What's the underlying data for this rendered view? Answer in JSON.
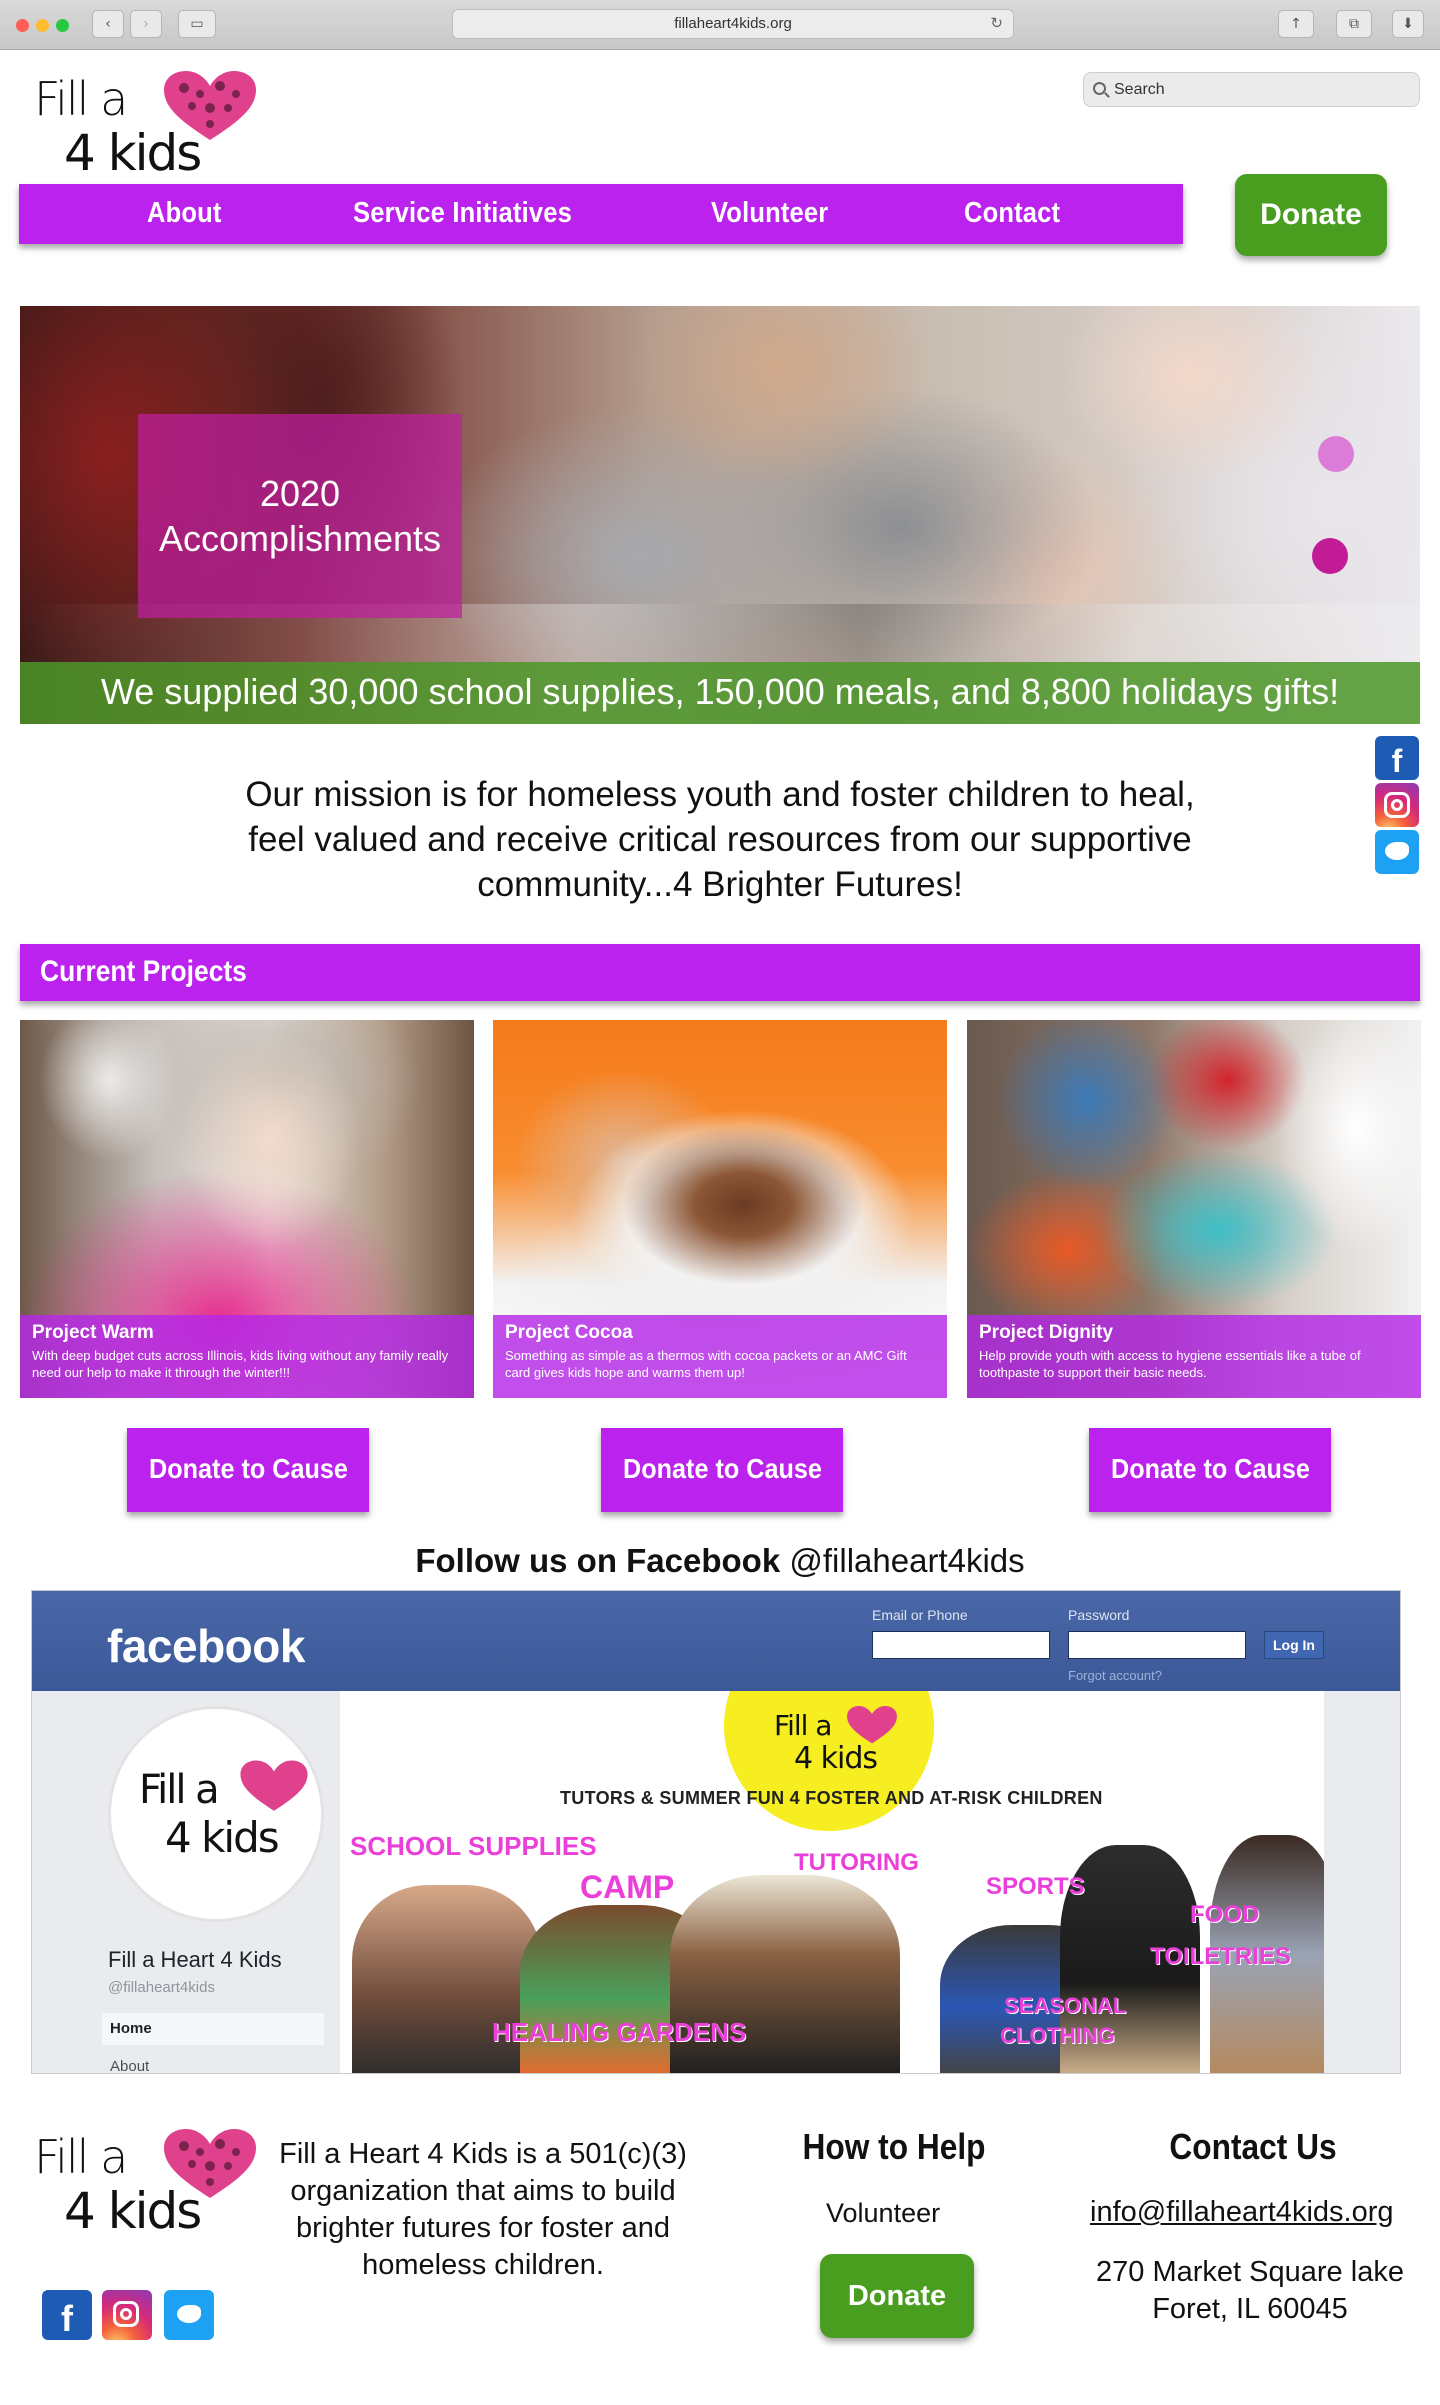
{
  "browser": {
    "url": "fillaheart4kids.org"
  },
  "logo": {
    "line1": "Fill a",
    "line2": "4 kids",
    "heart_color": "#e0418d"
  },
  "search": {
    "placeholder": "Search",
    "icon": "search-icon"
  },
  "nav": {
    "items": [
      "About",
      "Service Initiatives",
      "Volunteer",
      "Contact"
    ],
    "donate_label": "Donate",
    "bar_color": "#bb22ee",
    "donate_color": "#4a9e1f"
  },
  "hero": {
    "overlay_line1": "2020",
    "overlay_line2": "Accomplishments",
    "banner": "We supplied 30,000 school supplies, 150,000 meals, and 8,800 holidays gifts!"
  },
  "social": {
    "facebook": "facebook-icon",
    "instagram": "instagram-icon",
    "twitter": "twitter-icon"
  },
  "mission": {
    "text": "Our mission is for homeless youth and foster children to heal, feel valued and receive critical resources from our supportive community...4 Brighter Futures!"
  },
  "projects": {
    "heading": "Current Projects",
    "cards": [
      {
        "title": "Project Warm",
        "description": "With deep budget cuts across Illinois, kids living without any family really need our help to make it through the winter!!!"
      },
      {
        "title": "Project Cocoa",
        "description": "Something as simple as a thermos with cocoa packets or an AMC Gift card gives kids hope and warms them up!"
      },
      {
        "title": "Project Dignity",
        "description": "Help provide youth with access to hygiene essentials like a tube of toothpaste to support their basic needs."
      }
    ],
    "donate_label": "Donate to Cause"
  },
  "facebook_embed": {
    "follow_bold": "Follow us on Facebook",
    "follow_handle": "@fillaheart4kids",
    "brand": "facebook",
    "email_label": "Email or Phone",
    "password_label": "Password",
    "login_label": "Log In",
    "forgot_label": "Forgot account?",
    "page_name": "Fill a Heart 4 Kids",
    "page_handle": "@fillaheart4kids",
    "menu": [
      "Home",
      "About"
    ],
    "cover": {
      "logo_line1": "Fill a",
      "logo_line2": "4 kids",
      "tagline": "TUTORS & SUMMER FUN 4 FOSTER AND AT-RISK CHILDREN",
      "labels": [
        "SCHOOL SUPPLIES",
        "CAMP",
        "TUTORING",
        "SPORTS",
        "FOOD",
        "TOILETRIES",
        "HEALING GARDENS",
        "SEASONAL",
        "CLOTHING"
      ]
    }
  },
  "footer": {
    "about": "Fill a Heart 4 Kids is a 501(c)(3) organization that aims to build brighter futures for foster and homeless children.",
    "help_heading": "How to Help",
    "help_volunteer": "Volunteer",
    "help_donate": "Donate",
    "contact_heading": "Contact Us",
    "email": "info@fillaheart4kids.org",
    "address_line1": "270 Market Square lake",
    "address_line2": "Foret, IL 60045"
  }
}
